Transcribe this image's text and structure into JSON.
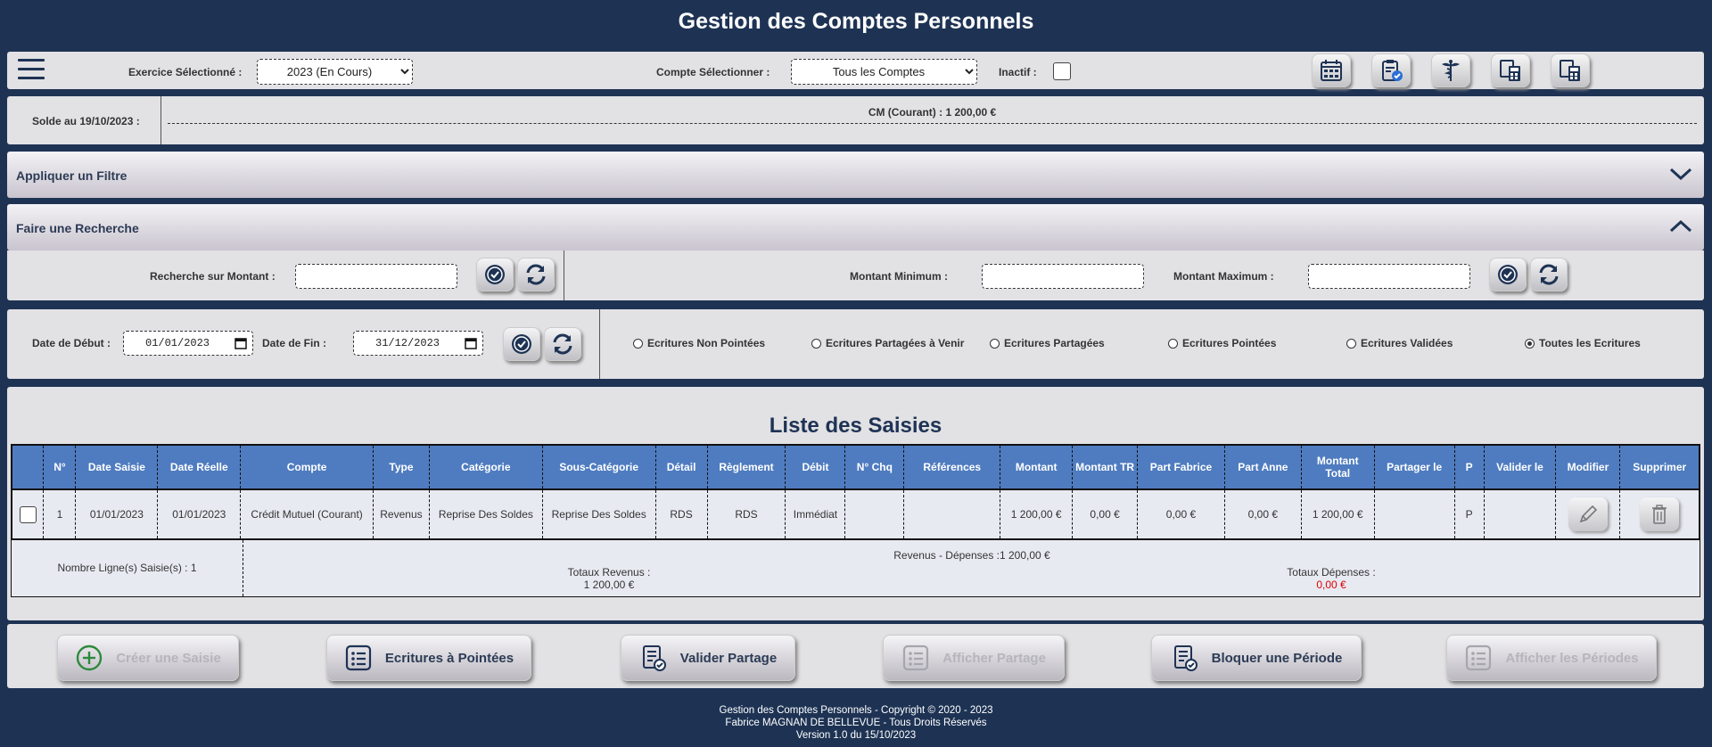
{
  "app_title": "Gestion des Comptes Personnels",
  "toolbar": {
    "exercice_label": "Exercice Sélectionné :",
    "exercice_value": "2023 (En Cours)",
    "compte_label": "Compte Sélectionner :",
    "compte_value": "Tous les Comptes",
    "inactif_label": "Inactif :",
    "inactif_checked": false,
    "icons": [
      "calendar-grid-icon",
      "clipboard-check-icon",
      "medical-caduceus-icon",
      "calculator-docs-icon",
      "calculator-docs-alt-icon"
    ]
  },
  "solde": {
    "label": "Solde au 19/10/2023 :",
    "value": "CM (Courant) : 1 200,00 €"
  },
  "filter_section": {
    "title": "Appliquer un Filtre",
    "expanded": false
  },
  "search_section": {
    "title": "Faire une Recherche",
    "expanded": true,
    "montant_label": "Recherche sur Montant :",
    "montant_value": "",
    "min_label": "Montant Minimum :",
    "min_value": "",
    "max_label": "Montant Maximum :",
    "max_value": ""
  },
  "date_filter": {
    "start_label": "Date de Début :",
    "start_value": "01/01/2023",
    "end_label": "Date de Fin :",
    "end_value": "31/12/2023"
  },
  "radios": [
    {
      "label": "Ecritures Non Pointées",
      "selected": false
    },
    {
      "label": "Ecritures Partagées à Venir",
      "selected": false
    },
    {
      "label": "Ecritures Partagées",
      "selected": false
    },
    {
      "label": "Ecritures Pointées",
      "selected": false
    },
    {
      "label": "Ecritures Validées",
      "selected": false
    },
    {
      "label": "Toutes les Ecritures",
      "selected": true
    }
  ],
  "list": {
    "title": "Liste des Saisies",
    "columns": [
      "",
      "N°",
      "Date Saisie",
      "Date Réelle",
      "Compte",
      "Type",
      "Catégorie",
      "Sous-Catégorie",
      "Détail",
      "Règlement",
      "Débit",
      "N° Chq",
      "Références",
      "Montant",
      "Montant TR",
      "Part Fabrice",
      "Part Anne",
      "Montant Total",
      "Partager le",
      "P",
      "Valider le",
      "Modifier",
      "Supprimer"
    ],
    "rows": [
      [
        "",
        "1",
        "01/01/2023",
        "01/01/2023",
        "Crédit Mutuel (Courant)",
        "Revenus",
        "Reprise Des Soldes",
        "Reprise Des Soldes",
        "RDS",
        "RDS",
        "Immédiat",
        "",
        "",
        "1 200,00 €",
        "0,00 €",
        "0,00 €",
        "0,00 €",
        "1 200,00 €",
        "",
        "P",
        "",
        "",
        ""
      ]
    ],
    "summary": {
      "count_label": "Nombre Ligne(s) Saisie(s) : 1",
      "balance": "Revenus - Dépenses :1 200,00 €",
      "revenus_label": "Totaux Revenus :",
      "revenus_value": "1 200,00 €",
      "depenses_label": "Totaux Dépenses :",
      "depenses_value": "0,00 €",
      "depenses_color": "#e00000"
    }
  },
  "actions": [
    {
      "label": "Créer une Saisie",
      "enabled": false,
      "icon": "plus-circle-icon"
    },
    {
      "label": "Ecritures à Pointées",
      "enabled": true,
      "icon": "list-icon"
    },
    {
      "label": "Valider Partage",
      "enabled": true,
      "icon": "document-check-icon"
    },
    {
      "label": "Afficher Partage",
      "enabled": false,
      "icon": "list-icon"
    },
    {
      "label": "Bloquer une Période",
      "enabled": true,
      "icon": "document-check-icon"
    },
    {
      "label": "Afficher les Périodes",
      "enabled": false,
      "icon": "list-icon"
    }
  ],
  "footer": {
    "line1": "Gestion des Comptes Personnels - Copyright © 2020 - 2023",
    "line2": "Fabrice MAGNAN DE BELLEVUE - Tous Droits Réservés",
    "line3": "Version 1.0 du 15/10/2023"
  }
}
